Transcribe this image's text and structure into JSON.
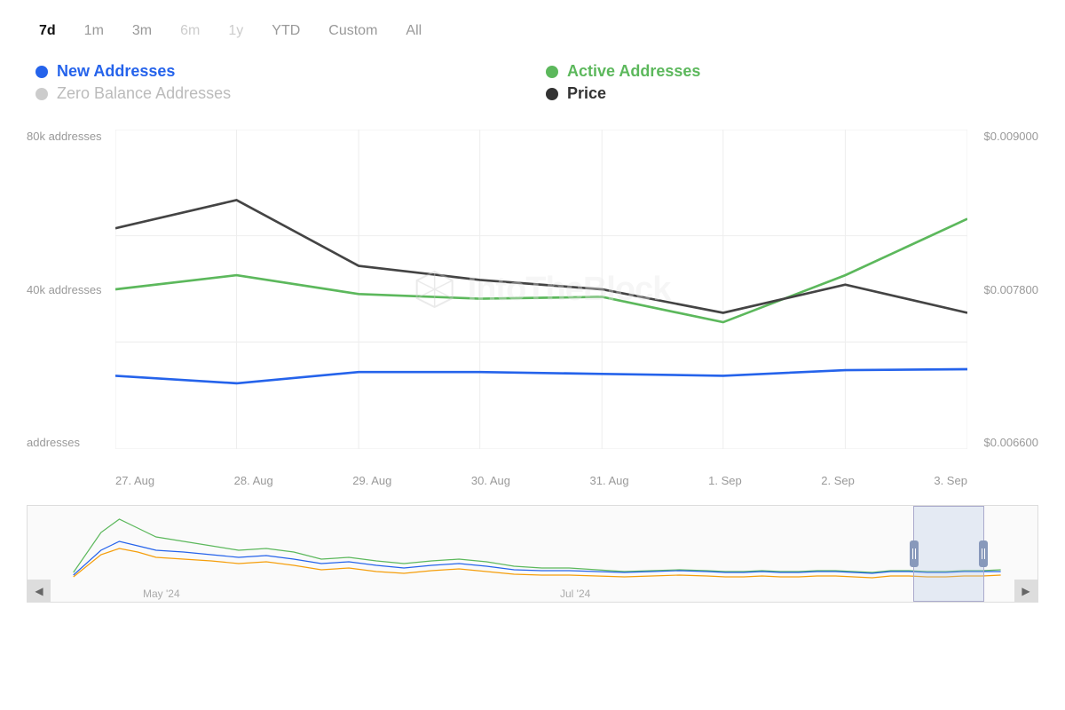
{
  "timeRange": {
    "buttons": [
      {
        "label": "7d",
        "active": true,
        "disabled": false
      },
      {
        "label": "1m",
        "active": false,
        "disabled": false
      },
      {
        "label": "3m",
        "active": false,
        "disabled": false
      },
      {
        "label": "6m",
        "active": false,
        "disabled": true
      },
      {
        "label": "1y",
        "active": false,
        "disabled": true
      },
      {
        "label": "YTD",
        "active": false,
        "disabled": false
      },
      {
        "label": "Custom",
        "active": false,
        "disabled": false
      },
      {
        "label": "All",
        "active": false,
        "disabled": false
      }
    ]
  },
  "legend": {
    "items": [
      {
        "label": "New Addresses",
        "color": "#2563eb",
        "muted": false,
        "id": "new-addresses"
      },
      {
        "label": "Active Addresses",
        "color": "#5cb85c",
        "muted": false,
        "id": "active-addresses"
      },
      {
        "label": "Zero Balance Addresses",
        "color": "#ccc",
        "muted": true,
        "id": "zero-balance"
      },
      {
        "label": "Price",
        "color": "#333",
        "muted": false,
        "id": "price"
      }
    ]
  },
  "yAxis": {
    "left": [
      "80k addresses",
      "40k addresses",
      "addresses"
    ],
    "right": [
      "$0.009000",
      "$0.007800",
      "$0.006600"
    ]
  },
  "xAxis": {
    "labels": [
      "27. Aug",
      "28. Aug",
      "29. Aug",
      "30. Aug",
      "31. Aug",
      "1. Sep",
      "2. Sep",
      "3. Sep"
    ]
  },
  "miniChart": {
    "xLabels": [
      "May '24",
      "Jul '24"
    ]
  },
  "watermark": "IntoTheBlock"
}
